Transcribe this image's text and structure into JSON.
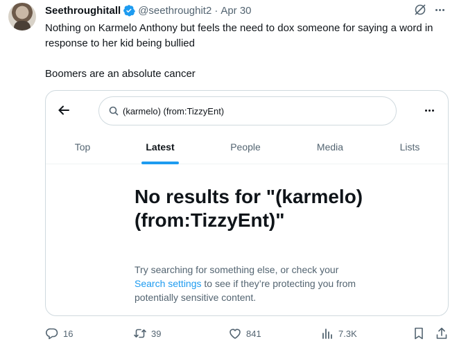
{
  "tweet": {
    "display_name": "Seethroughitall",
    "handle": "@seethroughit2",
    "separator": "·",
    "date": "Apr 30",
    "text_line1": "Nothing on Karmelo Anthony but feels the need to dox someone for saying a word in response to her kid being bullied",
    "text_line2": "Boomers are an absolute cancer",
    "accent_color": "#1d9bf0"
  },
  "card": {
    "search_query": "(karmelo) (from:TizzyEnt)",
    "tabs": [
      {
        "label": "Top"
      },
      {
        "label": "Latest",
        "active": true
      },
      {
        "label": "People"
      },
      {
        "label": "Media"
      },
      {
        "label": "Lists"
      }
    ],
    "no_results_title": "No results for \"(karmelo) (from:TizzyEnt)\"",
    "body_pre": "Try searching for something else, or check your ",
    "body_link": "Search settings",
    "body_post": " to see if they’re protecting you from potentially sensitive content."
  },
  "actions": {
    "replies": "16",
    "reposts": "39",
    "likes": "841",
    "views": "7.3K"
  },
  "icons": [
    "verified-badge-icon",
    "grok-icon",
    "more-icon",
    "back-arrow-icon",
    "search-icon",
    "reply-icon",
    "repost-icon",
    "like-icon",
    "views-icon",
    "bookmark-icon",
    "share-icon"
  ]
}
